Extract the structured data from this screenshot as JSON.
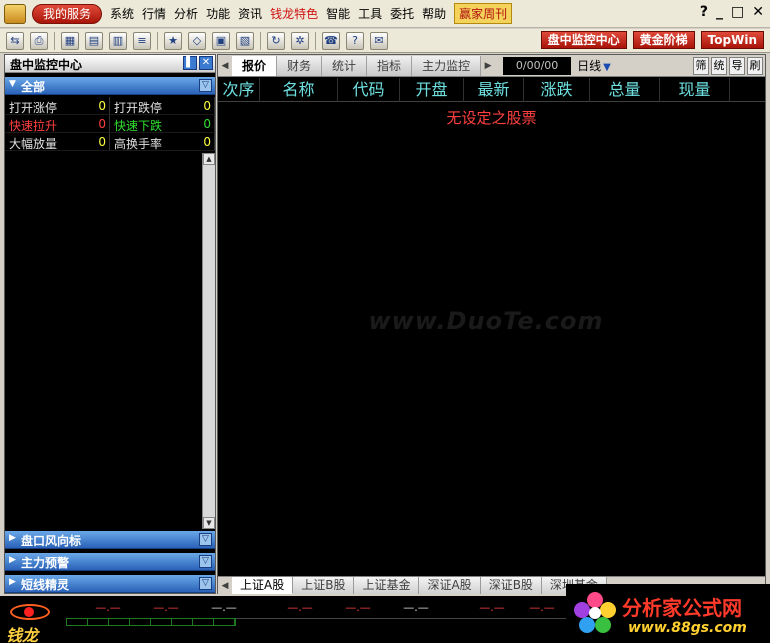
{
  "menubar": {
    "my_service": "我的服务",
    "items": [
      "系统",
      "行情",
      "分析",
      "功能",
      "资讯",
      "钱龙特色",
      "智能",
      "工具",
      "委托",
      "帮助"
    ],
    "highlight_item": "钱龙特色",
    "weekly": "赢家周刊",
    "help_icon": "?",
    "minimize_icon": "_",
    "maximize_icon": "□",
    "close_icon": "✕"
  },
  "toolbar": {
    "buttons": [
      "盘中监控中心",
      "黄金阶梯",
      "TopWin"
    ]
  },
  "left_panel": {
    "title": "盘中监控中心",
    "groups": {
      "all": "全部",
      "g2": "盘口风向标",
      "g3": "主力预警",
      "g4": "短线精灵"
    },
    "signals": [
      {
        "label": "打开涨停",
        "count": "0",
        "color": "#e0e0e0"
      },
      {
        "label": "打开跌停",
        "count": "0",
        "color": "#e0e0e0"
      },
      {
        "label": "快速拉升",
        "count": "0",
        "color": "#ff4040"
      },
      {
        "label": "快速下跌",
        "count": "0",
        "color": "#30e030"
      },
      {
        "label": "大幅放量",
        "count": "0",
        "color": "#e0e0e0"
      },
      {
        "label": "高换手率",
        "count": "0",
        "color": "#e0e0e0"
      }
    ]
  },
  "main": {
    "tabs": [
      "报价",
      "财务",
      "统计",
      "指标",
      "主力监控"
    ],
    "active_tab": "报价",
    "quote_time": "0/00/00",
    "period": "日线",
    "small_btns": [
      "筛",
      "统",
      "导",
      "刷"
    ],
    "columns": [
      "次序",
      "名称",
      "代码",
      "开盘",
      "最新",
      "涨跌",
      "总量",
      "现量"
    ],
    "empty_message": "无设定之股票",
    "watermark": "www.DuoTe.com",
    "bottom_tabs": [
      "上证A股",
      "上证B股",
      "上证基金",
      "深证A股",
      "深证B股",
      "深圳基金"
    ],
    "active_bottom_tab": "上证A股"
  },
  "status": {
    "logo_text": "钱龙",
    "index_values": [
      "—.—",
      "—.—",
      "—.—",
      "—.—",
      "—.—",
      "—.—",
      "—.—",
      "—.—"
    ]
  },
  "brand": {
    "title": "分析家公式网",
    "url": "www.88gs.com"
  }
}
